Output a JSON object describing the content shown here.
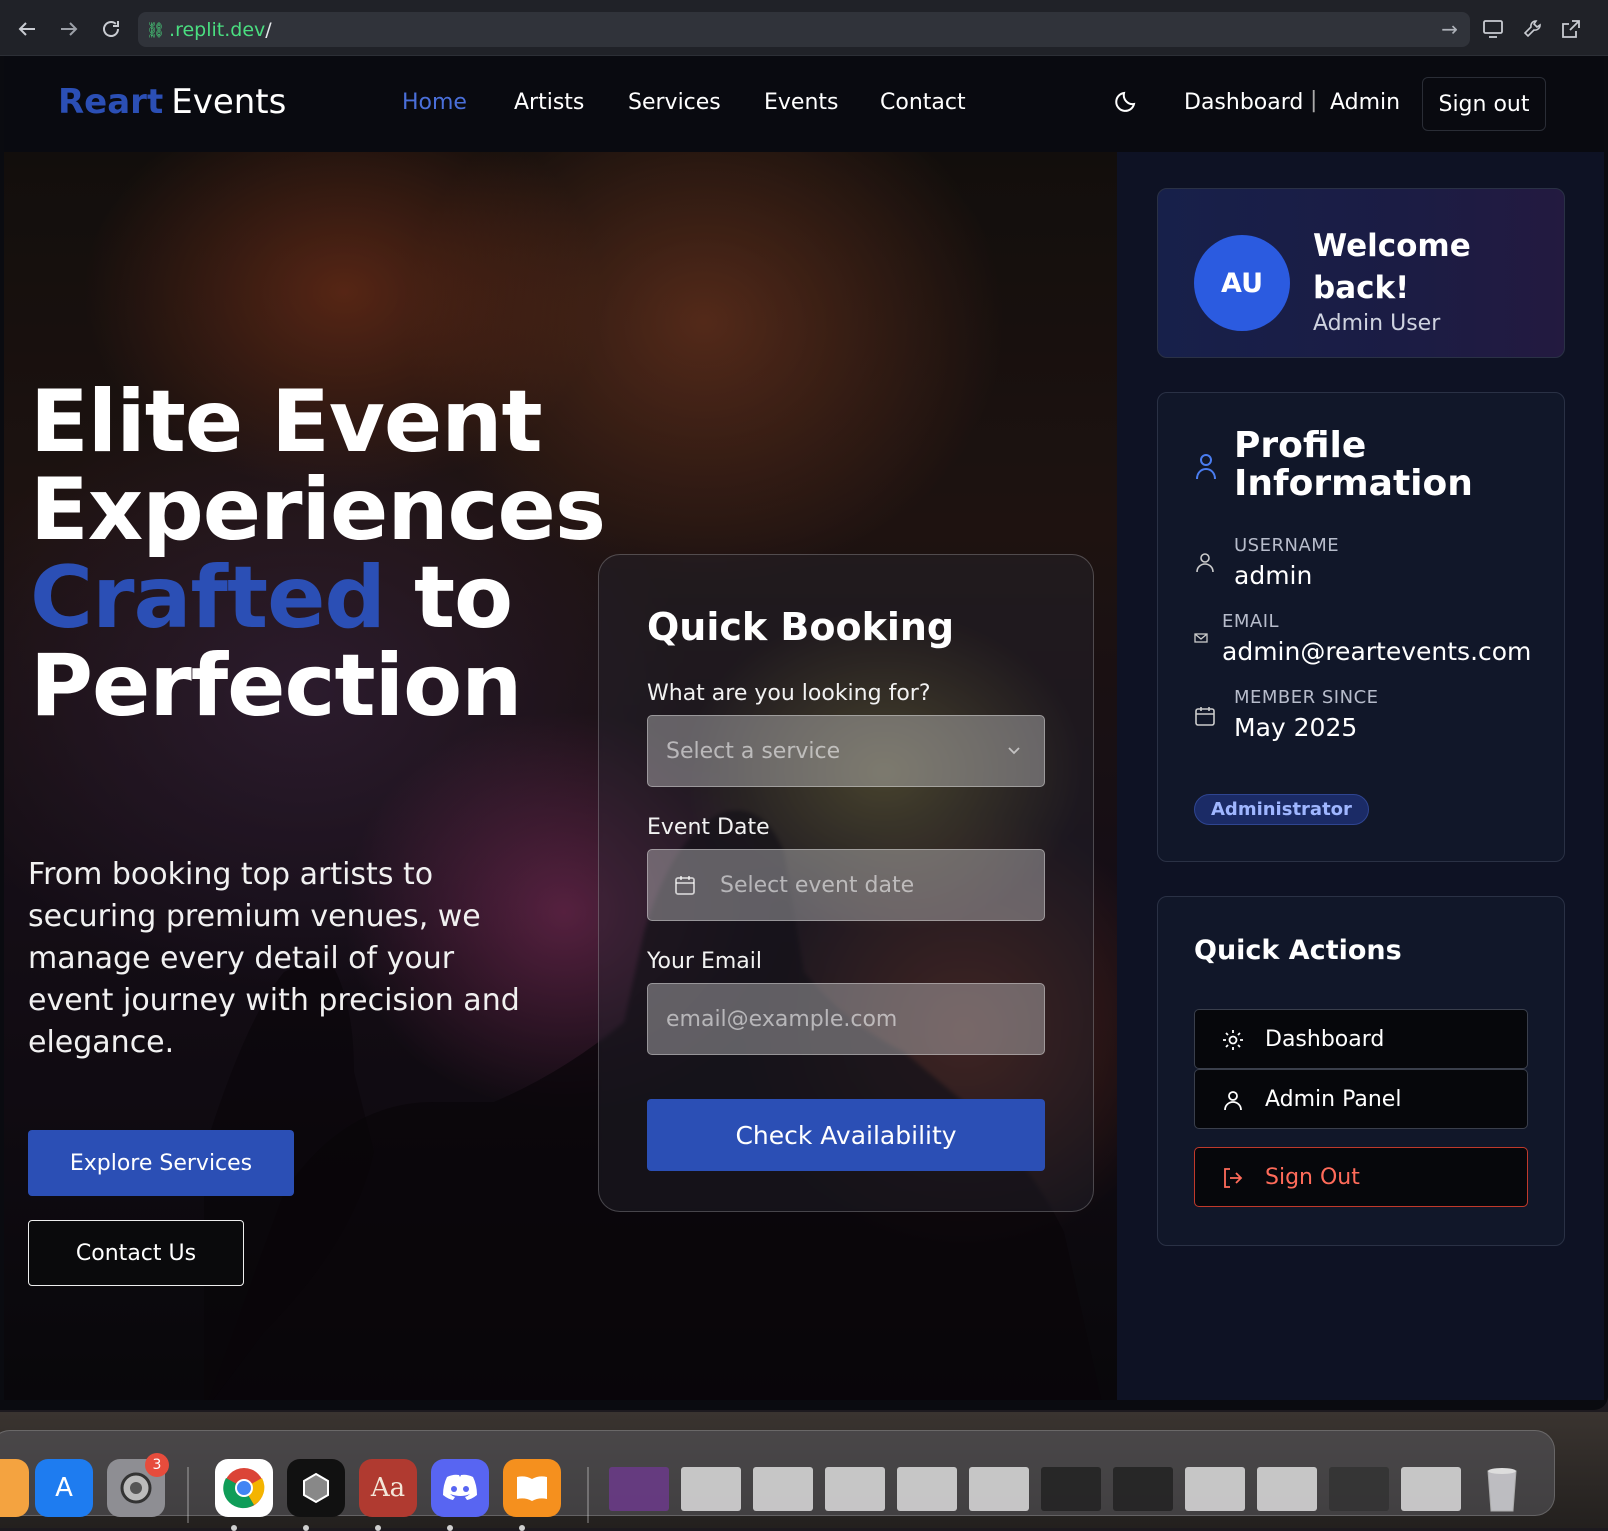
{
  "browser": {
    "url_prefix": "",
    "url_host": ".replit.dev",
    "url_path": "/"
  },
  "nav": {
    "logo_primary": "Reart",
    "logo_secondary": "Events",
    "links": [
      "Home",
      "Artists",
      "Services",
      "Events",
      "Contact"
    ],
    "active_link": "Home",
    "dashboard": "Dashboard",
    "separator": "|",
    "admin": "Admin",
    "signout": "Sign out"
  },
  "hero": {
    "title_line1": "Elite Event",
    "title_line2": "Experiences",
    "title_highlight": "Crafted",
    "title_line3_rest": "to",
    "title_line4": "Perfection",
    "lead": "From booking top artists to securing premium venues, we manage every detail of your event journey with precision and elegance.",
    "explore_button": "Explore Services",
    "contact_button": "Contact Us"
  },
  "quick_booking": {
    "title": "Quick Booking",
    "service_label": "What are you looking for?",
    "service_placeholder": "Select a service",
    "date_label": "Event Date",
    "date_placeholder": "Select event date",
    "email_label": "Your Email",
    "email_placeholder": "email@example.com",
    "submit": "Check Availability"
  },
  "welcome": {
    "initials": "AU",
    "heading": "Welcome back!",
    "name": "Admin User"
  },
  "profile": {
    "title": "Profile Information",
    "username_label": "USERNAME",
    "username": "admin",
    "email_label": "EMAIL",
    "email": "admin@reartevents.com",
    "member_label": "MEMBER SINCE",
    "member_since": "May 2025",
    "role": "Administrator"
  },
  "quick_actions": {
    "title": "Quick Actions",
    "dashboard": "Dashboard",
    "admin_panel": "Admin Panel",
    "sign_out": "Sign Out"
  },
  "dock": {
    "settings_badge": "3",
    "dictionary_label": "Aa"
  },
  "colors": {
    "accent": "#2b4fb5",
    "nav_active": "#4a6fd9",
    "danger": "#ff6b5a",
    "page_bg": "#0e1224"
  }
}
